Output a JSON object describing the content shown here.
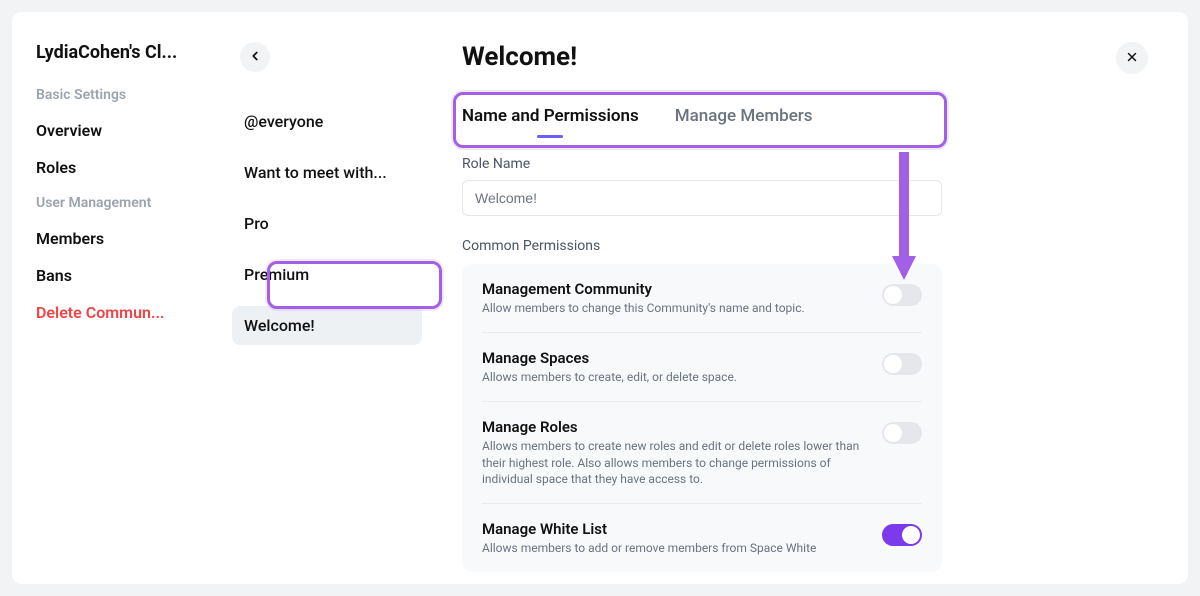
{
  "sidebar": {
    "title": "LydiaCohen's Cl...",
    "section1_label": "Basic Settings",
    "items1": [
      "Overview",
      "Roles"
    ],
    "section2_label": "User Management",
    "items2": [
      "Members",
      "Bans"
    ],
    "danger_item": "Delete Commun..."
  },
  "roles_list": [
    "@everyone",
    "Want to meet with...",
    "Pro",
    "Premium",
    "Welcome!"
  ],
  "main": {
    "title": "Welcome!",
    "tabs": [
      "Name and Permissions",
      "Manage Members"
    ],
    "role_name_label": "Role Name",
    "role_name_value": "Welcome!",
    "common_perm_label": "Common Permissions",
    "perms": [
      {
        "title": "Management Community",
        "desc": "Allow members to change this Community's name and topic.",
        "on": false
      },
      {
        "title": "Manage Spaces",
        "desc": "Allows members to create, edit, or delete space.",
        "on": false
      },
      {
        "title": "Manage Roles",
        "desc": "Allows members to create new roles and edit or delete roles lower than their highest role. Also allows members to change permissions of individual space that they have access to.",
        "on": false
      },
      {
        "title": "Manage White List",
        "desc": "Allows members to add or remove members from Space White",
        "on": true
      }
    ]
  }
}
